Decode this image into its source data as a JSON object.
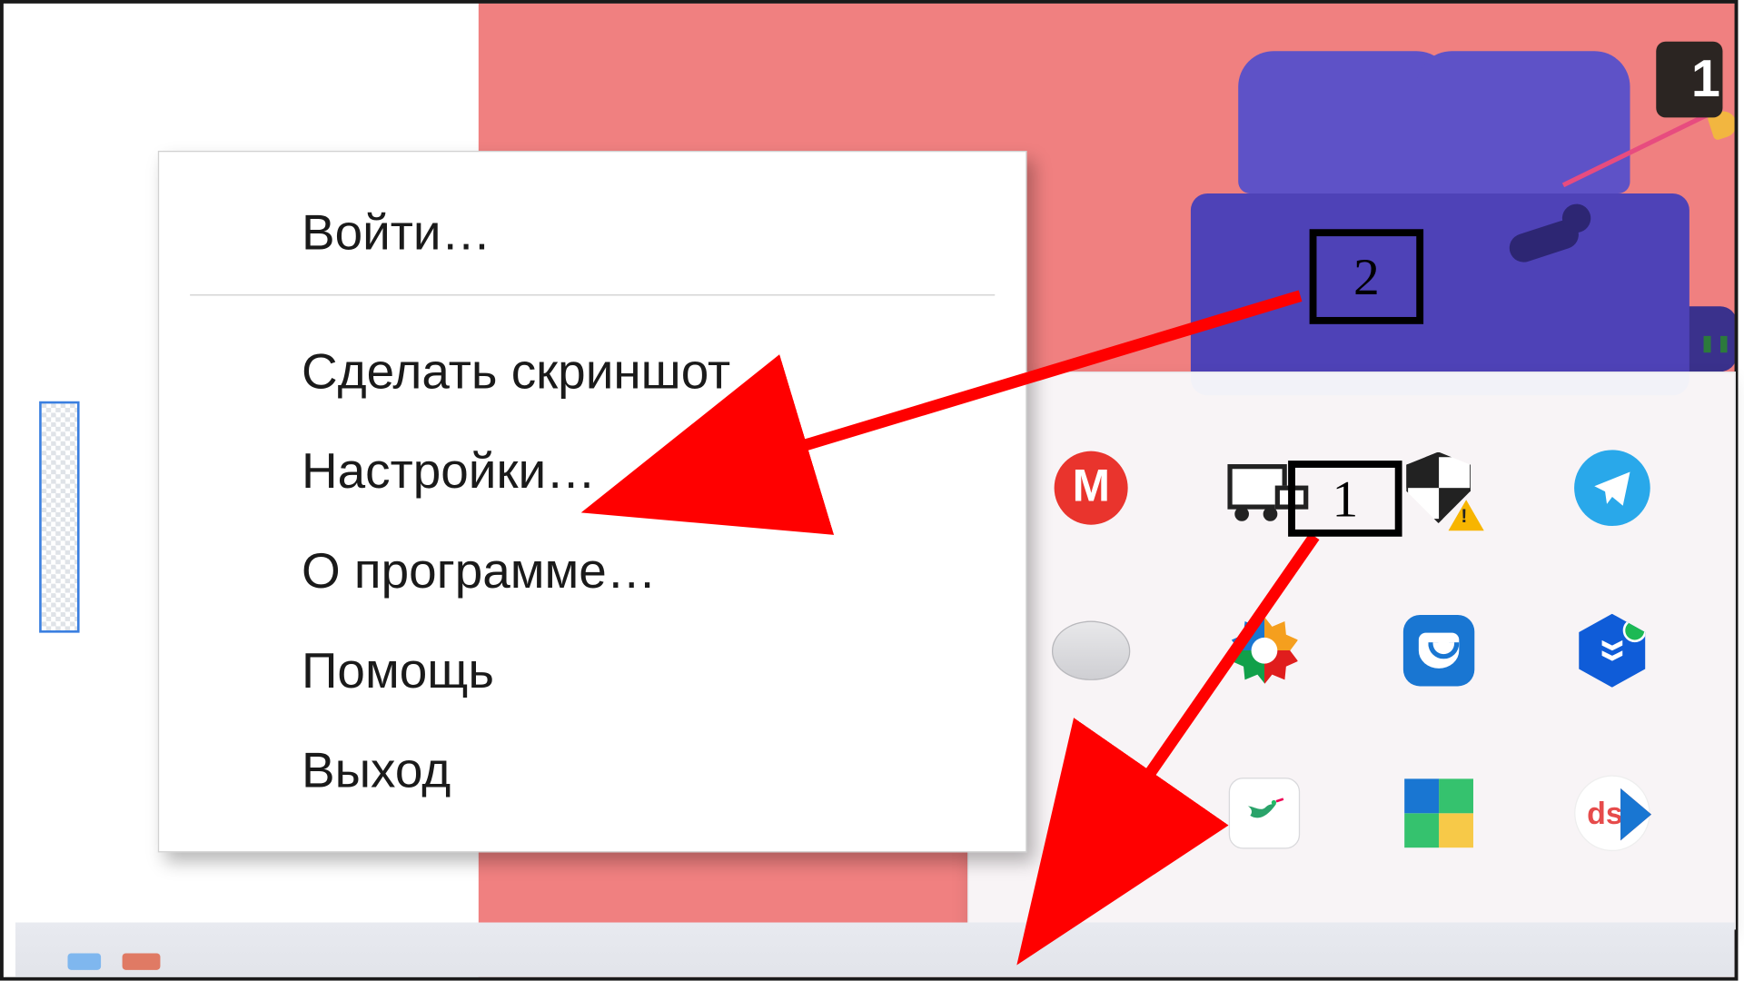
{
  "badge": {
    "label": "1"
  },
  "context_menu": {
    "login": "Войти…",
    "screenshot": "Сделать скриншот",
    "settings": "Настройки…",
    "about": "О программе…",
    "help": "Помощь",
    "exit": "Выход"
  },
  "tray": {
    "icons": {
      "mega": "M",
      "truck": "update-truck-icon",
      "shield": "defender-shield-icon",
      "telegram": "telegram-icon",
      "shell": "disc-shell-icon",
      "gear": "settings-gear-icon",
      "pocket": "pocket-icon",
      "hex": "driver-hex-icon",
      "feather": "lightshot-feather-icon",
      "bird": "colibri-app-icon",
      "quad": "ms-quad-icon",
      "ds": "ds"
    }
  },
  "steps": {
    "one": "1",
    "two": "2"
  }
}
